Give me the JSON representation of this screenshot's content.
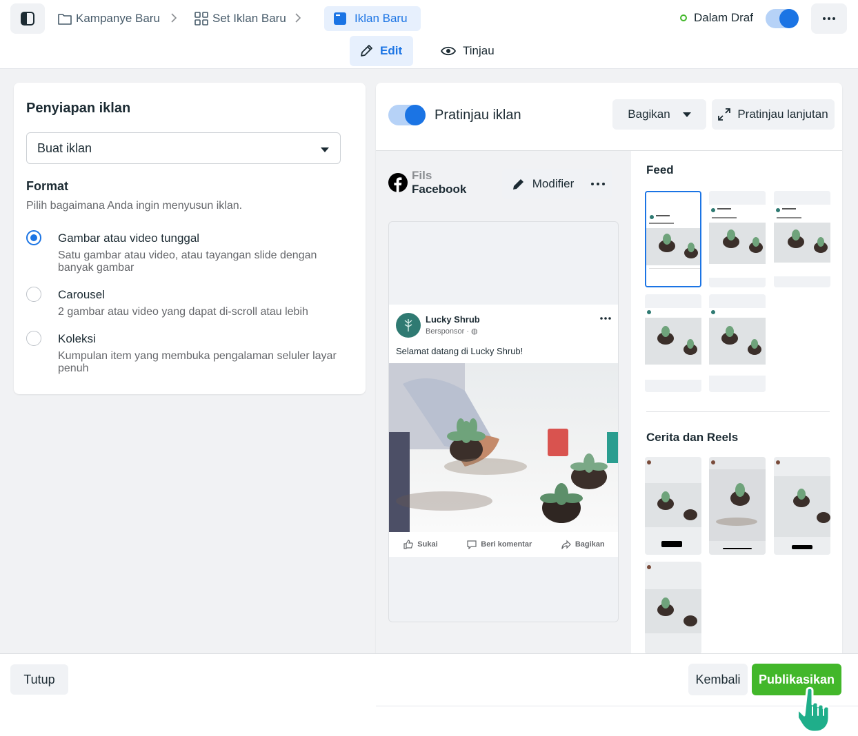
{
  "header": {
    "breadcrumbs": [
      {
        "label": "Kampanye Baru",
        "icon": "folder-icon"
      },
      {
        "label": "Set Iklan Baru",
        "icon": "grid-icon"
      },
      {
        "label": "Iklan Baru",
        "icon": "ad-window-icon"
      }
    ],
    "status_label": "Dalam Draf",
    "status_color": "#42b72a",
    "status_toggle_on": true,
    "tabs": [
      {
        "label": "Edit",
        "icon": "pencil-icon",
        "active": true
      },
      {
        "label": "Tinjau",
        "icon": "eye-icon",
        "active": false
      }
    ]
  },
  "setup": {
    "title": "Penyiapan iklan",
    "dropdown_value": "Buat iklan",
    "format_title": "Format",
    "format_subtitle": "Pilih bagaimana Anda ingin menyusun iklan.",
    "options": [
      {
        "label": "Gambar atau video tunggal",
        "desc": "Satu gambar atau video, atau tayangan slide dengan banyak gambar",
        "selected": true
      },
      {
        "label": "Carousel",
        "desc": "2 gambar atau video yang dapat di-scroll atau lebih",
        "selected": false
      },
      {
        "label": "Koleksi",
        "desc": "Kumpulan item yang membuka pengalaman seluler layar penuh",
        "selected": false
      }
    ]
  },
  "preview": {
    "toggle_on": true,
    "title": "Pratinjau iklan",
    "share_label": "Bagikan",
    "advanced_label": "Pratinjau lanjutan",
    "placement_line1": "Fils",
    "placement_line2": "Facebook",
    "modify_label": "Modifier",
    "post": {
      "page_name": "Lucky Shrub",
      "sponsored": "Bersponsor",
      "text": "Selamat datang di Lucky Shrub!",
      "actions": [
        "Sukai",
        "Beri komentar",
        "Bagikan"
      ]
    },
    "feed_heading": "Feed",
    "stories_heading": "Cerita dan Reels"
  },
  "footer": {
    "close_label": "Tutup",
    "back_label": "Kembali",
    "publish_label": "Publikasikan"
  },
  "colors": {
    "accent": "#1b74e4",
    "publish": "#42b72a"
  }
}
